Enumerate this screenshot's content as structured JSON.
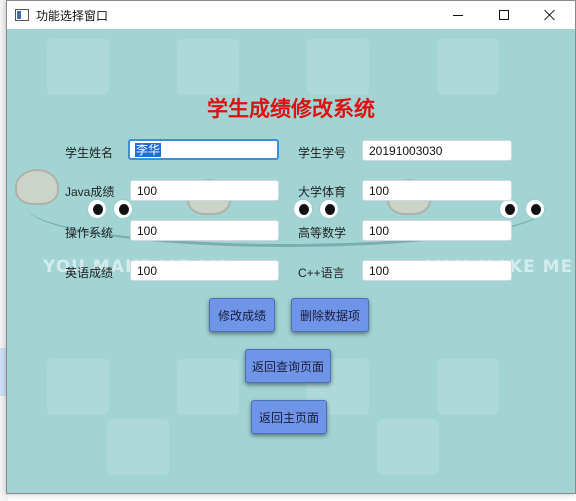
{
  "window": {
    "title": "功能选择窗口",
    "icon": "app-window-icon",
    "controls": [
      "minimize-icon",
      "maximize-icon",
      "close-icon"
    ]
  },
  "background": {
    "watermark_left": "YOU MAKE ME SM",
    "watermark_right": "YOU MAKE ME SM"
  },
  "form": {
    "title": "学生成绩修改系统",
    "fields": {
      "name": {
        "label": "学生姓名",
        "value": "李华"
      },
      "student_id": {
        "label": "学生学号",
        "value": "20191003030"
      },
      "java": {
        "label": "Java成绩",
        "value": "100"
      },
      "pe": {
        "label": "大学体育",
        "value": "100"
      },
      "os": {
        "label": "操作系统",
        "value": "100"
      },
      "math": {
        "label": "高等数学",
        "value": "100"
      },
      "english": {
        "label": "英语成绩",
        "value": "100"
      },
      "cpp": {
        "label": "C++语言",
        "value": "100"
      }
    }
  },
  "buttons": {
    "modify": "修改成绩",
    "delete": "删除数据项",
    "back_query": "返回查询页面",
    "back_main": "返回主页面"
  },
  "colors": {
    "client_bg": "#a2d4d4",
    "title_red": "#e01010",
    "button_bg": "#6f95e8"
  }
}
